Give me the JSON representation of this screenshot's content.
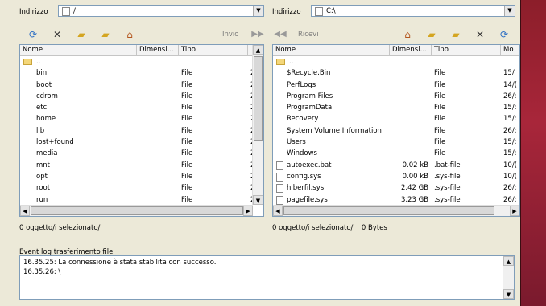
{
  "left": {
    "address_label": "Indirizzo",
    "address_value": "/",
    "send_label": "Invio",
    "columns": [
      "Nome",
      "Dimensi...",
      "Tipo",
      ""
    ],
    "parent": "..",
    "rows": [
      {
        "name": "bin",
        "type": "File",
        "extra": "2"
      },
      {
        "name": "boot",
        "type": "File",
        "extra": "2"
      },
      {
        "name": "cdrom",
        "type": "File",
        "extra": "2"
      },
      {
        "name": "etc",
        "type": "File",
        "extra": "2"
      },
      {
        "name": "home",
        "type": "File",
        "extra": "2"
      },
      {
        "name": "lib",
        "type": "File",
        "extra": "2"
      },
      {
        "name": "lost+found",
        "type": "File",
        "extra": "2"
      },
      {
        "name": "media",
        "type": "File",
        "extra": "2"
      },
      {
        "name": "mnt",
        "type": "File",
        "extra": "2"
      },
      {
        "name": "opt",
        "type": "File",
        "extra": "2"
      },
      {
        "name": "root",
        "type": "File",
        "extra": "2"
      },
      {
        "name": "run",
        "type": "File",
        "extra": "2"
      }
    ],
    "status": "0 oggetto/i selezionato/i"
  },
  "right": {
    "address_label": "Indirizzo",
    "address_value": "C:\\",
    "receive_label": "Ricevi",
    "columns": [
      "Nome",
      "Dimensi...",
      "Tipo",
      "Mo"
    ],
    "parent": "..",
    "rows": [
      {
        "name": "$Recycle.Bin",
        "size": "",
        "type": "File",
        "date": "15/",
        "kind": "folder"
      },
      {
        "name": "PerfLogs",
        "size": "",
        "type": "File",
        "date": "14/(",
        "kind": "folder"
      },
      {
        "name": "Program Files",
        "size": "",
        "type": "File",
        "date": "26/:",
        "kind": "folder"
      },
      {
        "name": "ProgramData",
        "size": "",
        "type": "File",
        "date": "15/:",
        "kind": "folder"
      },
      {
        "name": "Recovery",
        "size": "",
        "type": "File",
        "date": "15/:",
        "kind": "folder"
      },
      {
        "name": "System Volume Information",
        "size": "",
        "type": "File",
        "date": "26/:",
        "kind": "folder"
      },
      {
        "name": "Users",
        "size": "",
        "type": "File",
        "date": "15/:",
        "kind": "folder"
      },
      {
        "name": "Windows",
        "size": "",
        "type": "File",
        "date": "15/:",
        "kind": "folder"
      },
      {
        "name": "autoexec.bat",
        "size": "0.02 kB",
        "type": ".bat-file",
        "date": "10/(",
        "kind": "file"
      },
      {
        "name": "config.sys",
        "size": "0.00 kB",
        "type": ".sys-file",
        "date": "10/(",
        "kind": "file"
      },
      {
        "name": "hiberfil.sys",
        "size": "2.42 GB",
        "type": ".sys-file",
        "date": "26/:",
        "kind": "file"
      },
      {
        "name": "pagefile.sys",
        "size": "3.23 GB",
        "type": ".sys-file",
        "date": "26/:",
        "kind": "file"
      }
    ],
    "status": "0 oggetto/i selezionato/i   0 Bytes"
  },
  "log": {
    "label": "Event log trasferimento file",
    "lines": [
      "16.35.25: La connessione è stata stabilita con successo.",
      "16.35.26: \\"
    ]
  },
  "icons": {
    "refresh": "refresh-icon",
    "delete": "delete-icon",
    "folder_new": "new-folder-icon",
    "folder_up": "folder-up-icon",
    "home": "home-icon"
  }
}
